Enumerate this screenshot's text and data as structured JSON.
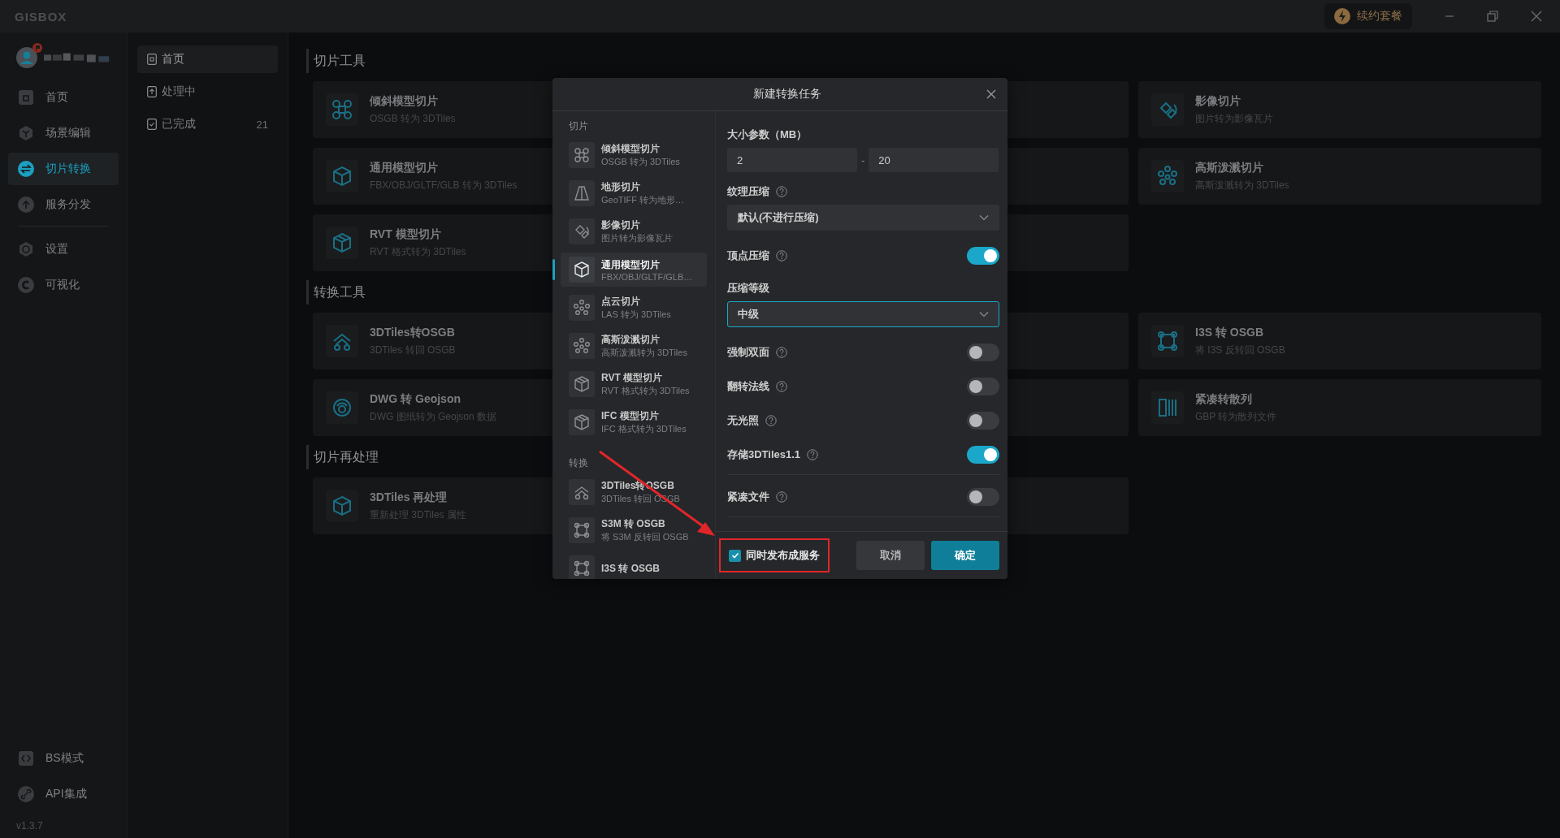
{
  "titlebar": {
    "logo": "GISBOX",
    "renew": "续约套餐"
  },
  "sidebar": {
    "items": [
      {
        "label": "首页",
        "selected": false
      },
      {
        "label": "场景编辑",
        "selected": false
      },
      {
        "label": "切片转换",
        "selected": true
      },
      {
        "label": "服务分发",
        "selected": false
      },
      {
        "label": "设置",
        "selected": false
      },
      {
        "label": "可视化",
        "selected": false
      }
    ],
    "bottom_items": [
      {
        "label": "BS模式"
      },
      {
        "label": "API集成"
      }
    ],
    "version": "v1.3.7"
  },
  "subnav": {
    "items": [
      {
        "label": "首页",
        "selected": true
      },
      {
        "label": "处理中",
        "selected": false
      },
      {
        "label": "已完成",
        "count": "21",
        "selected": false
      }
    ]
  },
  "sections": [
    {
      "title": "切片工具",
      "cards": [
        {
          "kind": "tool",
          "title": "倾斜模型切片",
          "subtitle": "OSGB 转为 3DTiles"
        },
        {
          "kind": "covered"
        },
        {
          "kind": "tool",
          "title": "影像切片",
          "subtitle": "图片转为影像瓦片"
        },
        {
          "kind": "tool",
          "title": "通用模型切片",
          "subtitle": "FBX/OBJ/GLTF/GLB 转为 3DTiles"
        },
        {
          "kind": "covered"
        },
        {
          "kind": "tool",
          "title": "高斯泼溅切片",
          "subtitle": "高斯泼溅转为 3DTiles"
        },
        {
          "kind": "tool",
          "title": "RVT 模型切片",
          "subtitle": "RVT 格式转为 3DTiles"
        },
        {
          "kind": "covered"
        }
      ]
    },
    {
      "title": "转换工具",
      "cards": [
        {
          "kind": "tool",
          "title": "3DTiles转OSGB",
          "subtitle": "3DTiles 转回 OSGB"
        },
        {
          "kind": "covered"
        },
        {
          "kind": "tool",
          "title": "I3S 转 OSGB",
          "subtitle": "将 I3S 反转回 OSGB"
        },
        {
          "kind": "tool",
          "title": "DWG 转 Geojson",
          "subtitle": "DWG 图纸转为 Geojson 数据"
        },
        {
          "kind": "covered"
        },
        {
          "kind": "tool",
          "title": "紧凑转散列",
          "subtitle": "GBP 转为散列文件"
        }
      ]
    },
    {
      "title": "切片再处理",
      "cards": [
        {
          "kind": "tool",
          "title": "3DTiles 再处理",
          "subtitle": "重新处理 3DTiles 属性"
        },
        {
          "kind": "covered"
        }
      ]
    }
  ],
  "dialog": {
    "title": "新建转换任务",
    "groups": [
      {
        "label": "切片",
        "items": [
          {
            "title": "倾斜模型切片",
            "subtitle": "OSGB 转为 3DTiles",
            "selected": false
          },
          {
            "title": "地形切片",
            "subtitle": "GeoTIFF 转为地形…",
            "selected": false
          },
          {
            "title": "影像切片",
            "subtitle": "图片转为影像瓦片",
            "selected": false
          },
          {
            "title": "通用模型切片",
            "subtitle": "FBX/OBJ/GLTF/GLB…",
            "selected": true
          },
          {
            "title": "点云切片",
            "subtitle": "LAS 转为 3DTiles",
            "selected": false
          },
          {
            "title": "高斯泼溅切片",
            "subtitle": "高斯泼溅转为 3DTiles",
            "selected": false
          },
          {
            "title": "RVT 模型切片",
            "subtitle": "RVT 格式转为 3DTiles",
            "selected": false
          },
          {
            "title": "IFC 模型切片",
            "subtitle": "IFC 格式转为 3DTiles",
            "selected": false
          }
        ]
      },
      {
        "label": "转换",
        "items": [
          {
            "title": "3DTiles转OSGB",
            "subtitle": "3DTiles 转回 OSGB",
            "selected": false
          },
          {
            "title": "S3M 转 OSGB",
            "subtitle": "将 S3M 反转回 OSGB",
            "selected": false
          },
          {
            "title": "I3S 转 OSGB",
            "selected": false
          }
        ]
      }
    ],
    "form": [
      {
        "kind": "range",
        "label": "大小参数（MB）",
        "help": false,
        "min": "2",
        "separator": "-",
        "max": "20"
      },
      {
        "kind": "select",
        "label": "纹理压缩",
        "help": true,
        "value": "默认(不进行压缩)",
        "focused": false
      },
      {
        "kind": "toggle",
        "label": "顶点压缩",
        "help": true,
        "on": true,
        "divider_after": false
      },
      {
        "kind": "select",
        "label": "压缩等级",
        "help": false,
        "value": "中级",
        "focused": true
      },
      {
        "kind": "toggle",
        "label": "强制双面",
        "help": true,
        "on": false,
        "divider_after": false
      },
      {
        "kind": "toggle",
        "label": "翻转法线",
        "help": true,
        "on": false,
        "divider_after": false
      },
      {
        "kind": "toggle",
        "label": "无光照",
        "help": true,
        "on": false,
        "divider_after": false
      },
      {
        "kind": "toggle",
        "label": "存储3DTiles1.1",
        "help": true,
        "on": true,
        "divider_after": true
      },
      {
        "kind": "toggle",
        "label": "紧凑文件",
        "help": true,
        "on": false,
        "divider_after": true
      }
    ],
    "publish": {
      "label": "同时发布成服务",
      "checked": true,
      "highlighted": true
    },
    "buttons": [
      {
        "label": "取消",
        "kind": "secondary"
      },
      {
        "label": "确定",
        "kind": "primary"
      }
    ]
  }
}
